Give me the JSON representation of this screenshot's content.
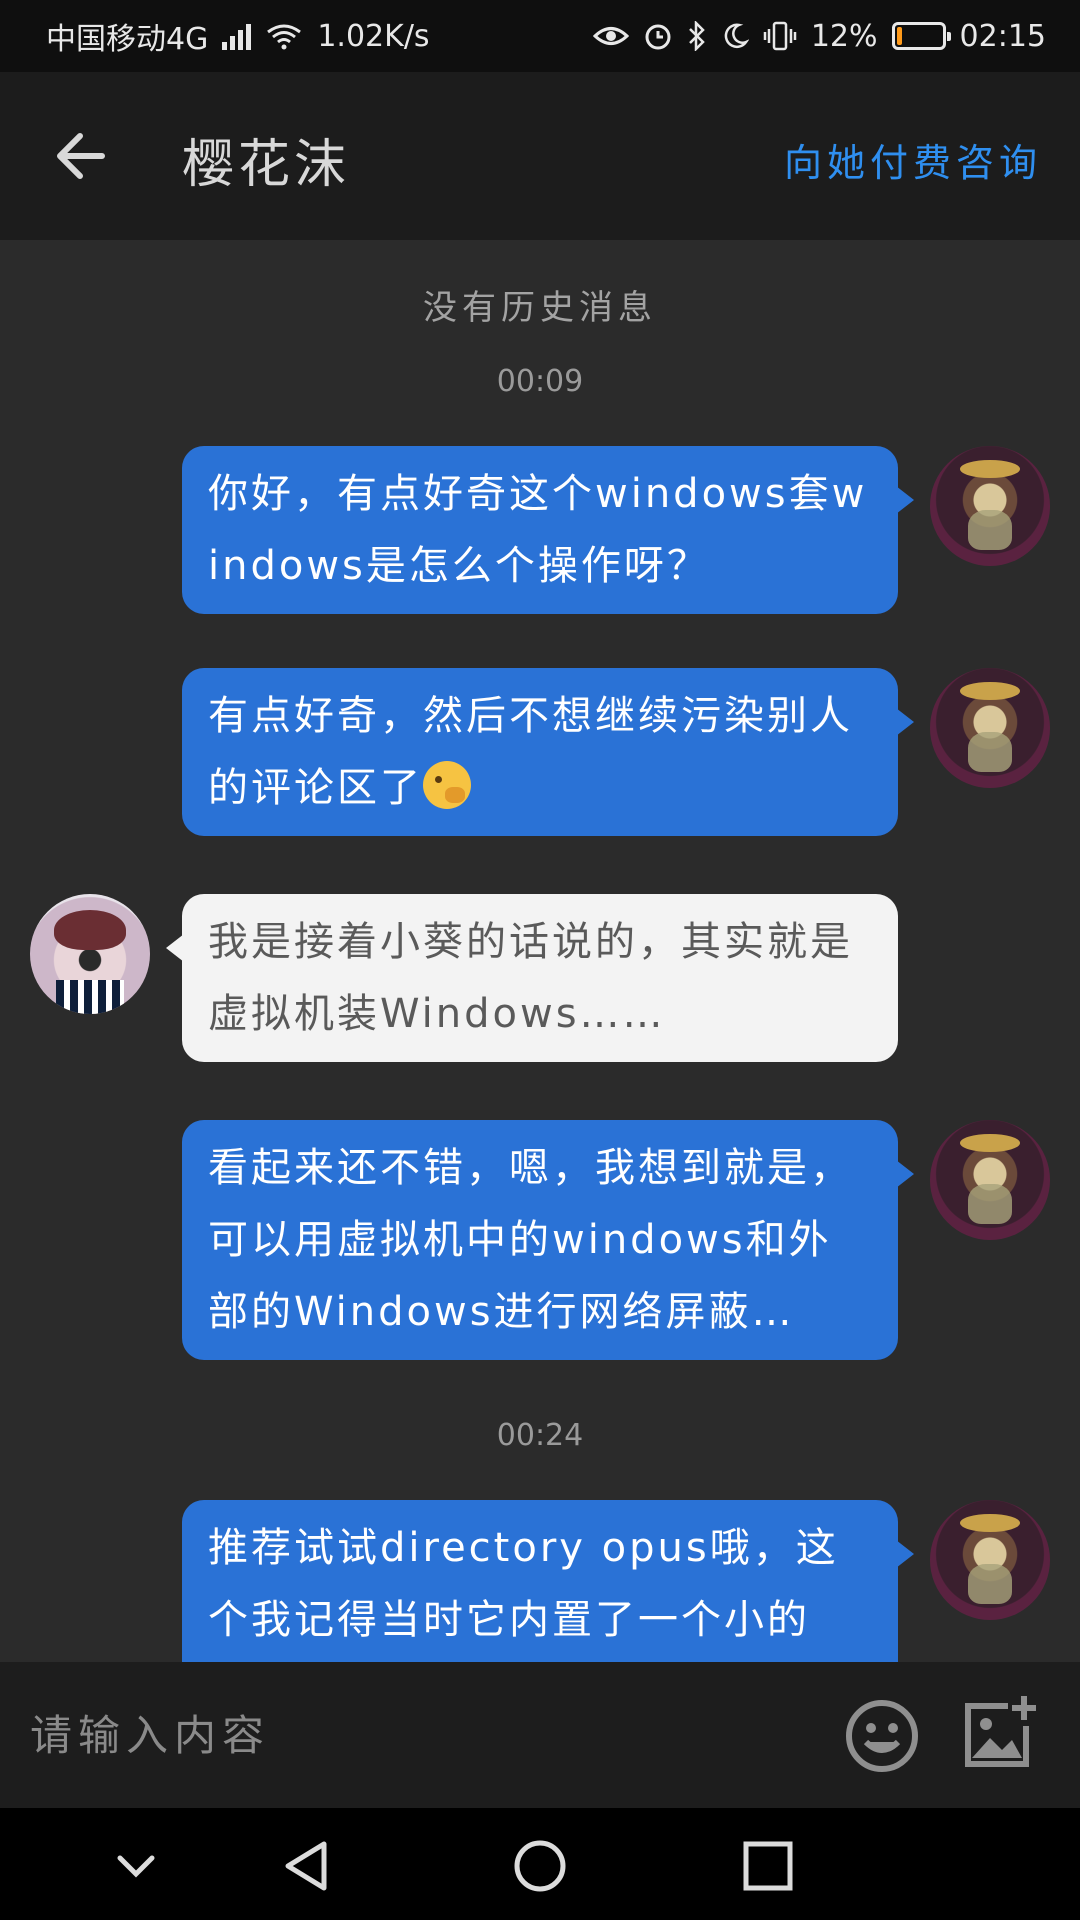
{
  "status_bar": {
    "carrier": "中国移动4G",
    "net_type": "4G",
    "speed": "1.02K/s",
    "battery_percent": "12%",
    "battery_level": 0.12,
    "time": "02:15"
  },
  "header": {
    "title": "樱花沫",
    "action_label": "向她付费咨询"
  },
  "chat": {
    "no_history": "没有历史消息",
    "times": [
      "00:09",
      "00:24"
    ],
    "messages": [
      {
        "side": "out",
        "text": "你好，有点好奇这个windows套windows是怎么个操作呀？"
      },
      {
        "side": "out",
        "text": "有点好奇，然后不想继续污染别人的评论区了"
      },
      {
        "side": "in",
        "text": "我是接着小葵的话说的，其实就是虚拟机装Windows……"
      },
      {
        "side": "out",
        "text": "看起来还不错，嗯，我想到就是，可以用虚拟机中的windows和外部的Windows进行网络屏蔽…"
      },
      {
        "side": "out",
        "text": "推荐试试directory opus哦，这个我记得当时它内置了一个小的"
      }
    ]
  },
  "input": {
    "placeholder": "请输入内容"
  },
  "colors": {
    "accent": "#2f8ff0",
    "bubble_out": "#2a72d6",
    "bubble_in": "#f3f3f3",
    "background": "#2b2b2b"
  },
  "icons": {
    "back": "arrow-left-icon",
    "emoji": "smiley-icon",
    "image": "image-add-icon",
    "nav": [
      "chevron-down-icon",
      "back-triangle-icon",
      "home-circle-icon",
      "recent-square-icon"
    ]
  }
}
